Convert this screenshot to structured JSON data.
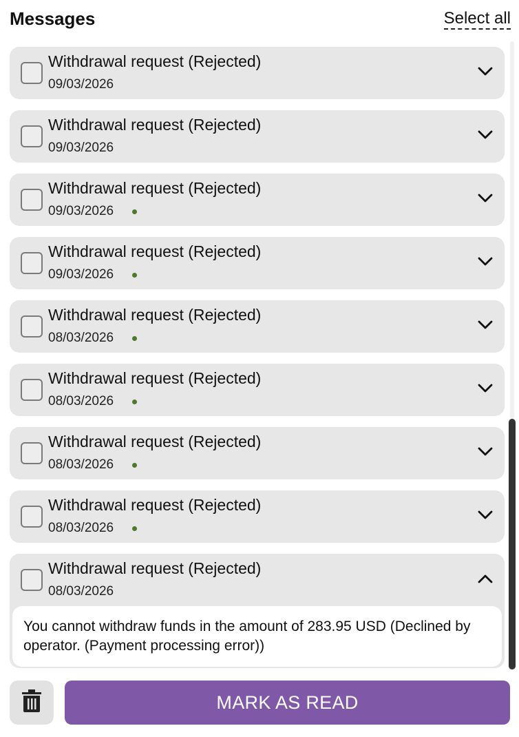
{
  "header": {
    "title": "Messages",
    "select_all": "Select all"
  },
  "messages": [
    {
      "title": "Withdrawal request (Rejected)",
      "date": "09/03/2026",
      "unread": false,
      "expanded": false
    },
    {
      "title": "Withdrawal request (Rejected)",
      "date": "09/03/2026",
      "unread": false,
      "expanded": false
    },
    {
      "title": "Withdrawal request (Rejected)",
      "date": "09/03/2026",
      "unread": true,
      "expanded": false
    },
    {
      "title": "Withdrawal request (Rejected)",
      "date": "09/03/2026",
      "unread": true,
      "expanded": false
    },
    {
      "title": "Withdrawal request (Rejected)",
      "date": "08/03/2026",
      "unread": true,
      "expanded": false
    },
    {
      "title": "Withdrawal request (Rejected)",
      "date": "08/03/2026",
      "unread": true,
      "expanded": false
    },
    {
      "title": "Withdrawal request (Rejected)",
      "date": "08/03/2026",
      "unread": true,
      "expanded": false
    },
    {
      "title": "Withdrawal request (Rejected)",
      "date": "08/03/2026",
      "unread": true,
      "expanded": false
    },
    {
      "title": "Withdrawal request (Rejected)",
      "date": "08/03/2026",
      "unread": false,
      "expanded": true,
      "body": "You cannot withdraw funds in the amount of 283.95 USD (Declined by operator. (Payment processing error))"
    }
  ],
  "footer": {
    "mark_as_read": "MARK AS READ",
    "delete_icon": "trash-icon"
  },
  "colors": {
    "accent": "#7f58a8",
    "unread_dot": "#4a7a2a",
    "card_bg": "#e7e7e7"
  }
}
